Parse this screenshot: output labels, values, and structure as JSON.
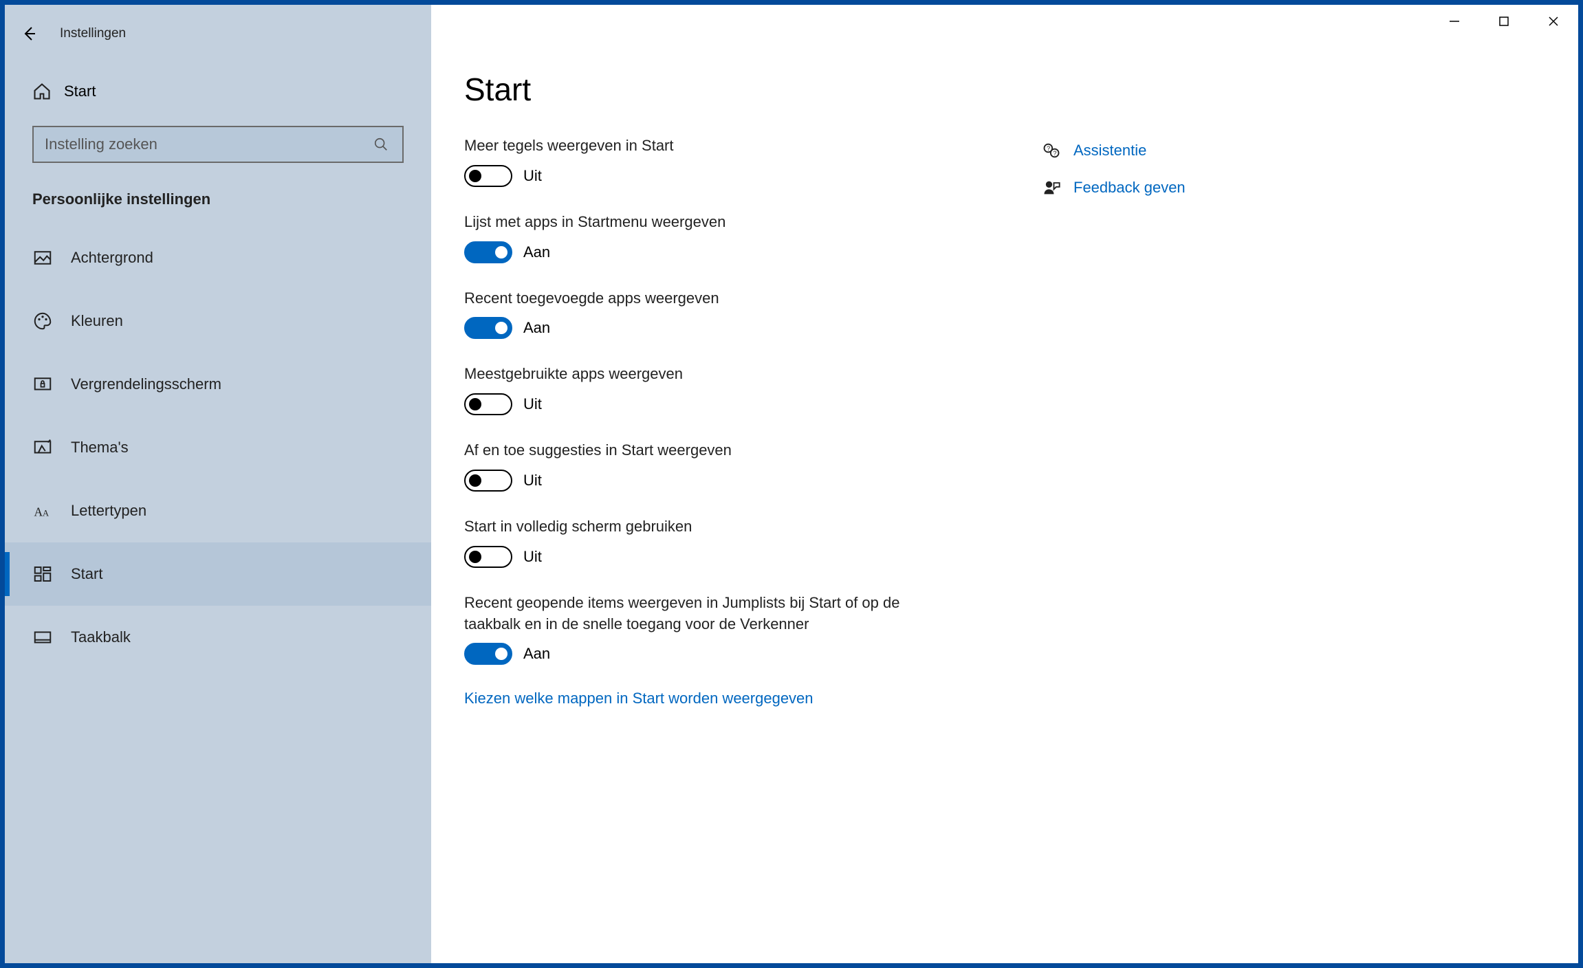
{
  "window": {
    "title": "Instellingen"
  },
  "sidebar": {
    "home_label": "Start",
    "search_placeholder": "Instelling zoeken",
    "section_heading": "Persoonlijke instellingen",
    "items": [
      {
        "key": "achtergrond",
        "label": "Achtergrond"
      },
      {
        "key": "kleuren",
        "label": "Kleuren"
      },
      {
        "key": "vergrendelingsscherm",
        "label": "Vergrendelingsscherm"
      },
      {
        "key": "themas",
        "label": "Thema's"
      },
      {
        "key": "lettertypen",
        "label": "Lettertypen"
      },
      {
        "key": "start",
        "label": "Start"
      },
      {
        "key": "taakbalk",
        "label": "Taakbalk"
      }
    ]
  },
  "main": {
    "page_title": "Start",
    "state_on": "Aan",
    "state_off": "Uit",
    "settings": [
      {
        "key": "meer-tegels",
        "label": "Meer tegels weergeven in Start",
        "on": false
      },
      {
        "key": "lijst-apps",
        "label": "Lijst met apps in Startmenu weergeven",
        "on": true
      },
      {
        "key": "recent-toegevoegd",
        "label": "Recent toegevoegde apps weergeven",
        "on": true
      },
      {
        "key": "meestgebruikt",
        "label": "Meestgebruikte apps weergeven",
        "on": false
      },
      {
        "key": "suggesties",
        "label": "Af en toe suggesties in Start weergeven",
        "on": false
      },
      {
        "key": "volledig-scherm",
        "label": "Start in volledig scherm gebruiken",
        "on": false
      },
      {
        "key": "recent-geopend",
        "label": "Recent geopende items weergeven in Jumplists bij Start of op de taakbalk en in de snelle toegang voor de Verkenner",
        "on": true
      }
    ],
    "extra_link": "Kiezen welke mappen in Start worden weergegeven",
    "aside": [
      {
        "key": "assistentie",
        "label": "Assistentie"
      },
      {
        "key": "feedback",
        "label": "Feedback geven"
      }
    ]
  }
}
